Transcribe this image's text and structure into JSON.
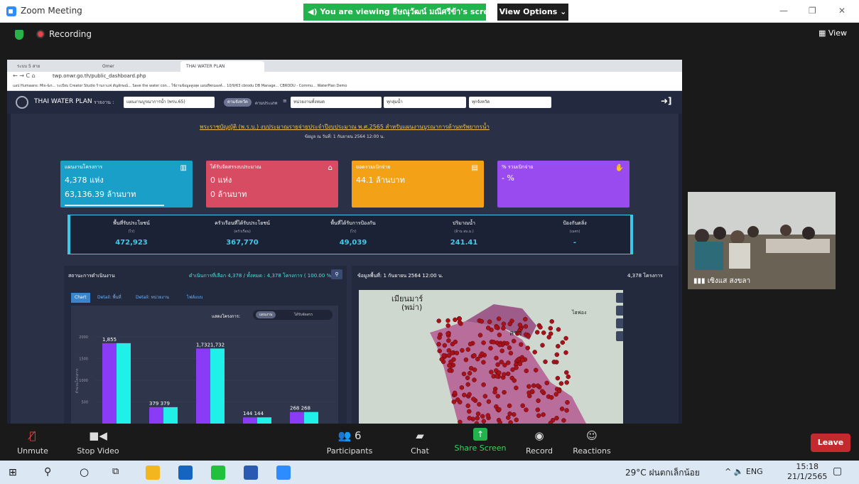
{
  "zoom": {
    "app_title": "Zoom Meeting",
    "share_banner": "You are viewing ธีษณุวัฒน์ มณีศรีข้า's screen",
    "view_options": "View Options",
    "recording": "Recording",
    "view": "View"
  },
  "browser": {
    "tabs": [
      "ระบบ 5 สาย",
      "Omer",
      "THAI WATER PLAN"
    ],
    "url": "twp.onwr.go.th/public_dashboard.php",
    "bookmarks": "แอป   Humaans: Mix-&n...   ระเบียบ   Creator Studio   ร้านกาแฟ สัญลักษณ์...   Save the water con...   ใช้งานข้อมูลสูงสุด   แผนทีพรมองค์...   10/9/63   cbrodu DB Manage...   CBRODU - Commu...   WaterPlan Demo"
  },
  "dashboard": {
    "brand": "THAI WATER PLAN",
    "nav_label": "รายงาน :",
    "nav_select": "แผนงานบูรณาการน้ำ (พรบ.65)",
    "pill_a": "ตามจังหวัด",
    "pill_b": "ตามประเภท",
    "select_agency": "หน่วยงานทั้งหมด",
    "select_basin": "ทุกลุ่มน้ำ",
    "select_province": "ทุกจังหวัด",
    "headline": "พระราชบัญญัติ (พ.ร.บ.) งบประมาณรายจ่ายประจำปีงบประมาณ พ.ศ.2565 สำหรับแผนงานบูรณาการด้านทรัพยากรน้ำ",
    "date": "ข้อมูล ณ วันที่: 1 กันยายน 2564 12:00 น.",
    "kpis": [
      {
        "title": "แผนงานโครงการ",
        "v1": "4,378 แห่ง",
        "v2": "63,136.39 ล้านบาท",
        "color": "#1aa0c8"
      },
      {
        "title": "ได้รับจัดสรรงบประมาณ",
        "v1": "0 แห่ง",
        "v2": "0 ล้านบาท",
        "color": "#d84c63"
      },
      {
        "title": "ยอดรวมเบิกจ่าย",
        "v1": "44.1 ล้านบาท",
        "v2": "",
        "color": "#f3a117"
      },
      {
        "title": "% รวมเบิกจ่าย",
        "v1": "- %",
        "v2": "",
        "color": "#9a4bf0"
      }
    ],
    "stats": [
      {
        "label": "พื้นที่รับประโยชน์",
        "unit": "(ไร่)",
        "value": "472,923"
      },
      {
        "label": "ครัวเรือนที่ได้รับประโยชน์",
        "unit": "(ครัวเรือน)",
        "value": "367,770"
      },
      {
        "label": "พื้นที่ได้รับการป้องกัน",
        "unit": "(ไร่)",
        "value": "49,039"
      },
      {
        "label": "ปริมาณน้ำ",
        "unit": "(ล้าน ลบ.ม.)",
        "value": "241.41"
      },
      {
        "label": "ป้องกันตลิ่ง",
        "unit": "(เมตร)",
        "value": "-"
      }
    ],
    "status_title": "สถานะการดำเนินงาน",
    "status_summary": "ดำเนินการที่เลือก 4,378 / ทั้งหมด : 4,378 โครงการ ( 100.00 % )",
    "chart_tabs": [
      "Chart",
      "Detail: พื้นที่",
      "Detail: หน่วยงาน",
      "ไฟล์แบบ"
    ],
    "filter_label": "แสดงโครงการ:",
    "filter_on": "แผนงาน",
    "filter_off": "ได้รับจัดสรร",
    "map_head": "ข้อมูลพื้นที่: 1 กันยายน 2564 12:00 น.",
    "map_count": "4,378 โครงการ",
    "map_labels": [
      "เมียนมาร์",
      "(พม่า)",
      "ลาว",
      "ไฮฟอง"
    ]
  },
  "chart_data": {
    "type": "bar",
    "ylabel": "จำนวนโครงการ",
    "ylim": [
      0,
      2000
    ],
    "yticks": [
      500,
      1000,
      1500,
      2000
    ],
    "series": [
      {
        "values": [
          1855,
          379,
          1732,
          144,
          268
        ],
        "color": "#8a3bf5"
      },
      {
        "values": [
          1855,
          379,
          1732,
          144,
          268
        ],
        "color": "#1ff0e8"
      }
    ],
    "bar_labels": [
      "1,855",
      "379  379",
      "1,7321,732",
      "144  144",
      "268  268"
    ]
  },
  "video": {
    "name": "เซิงแส สงขลา"
  },
  "toolbar": {
    "items": [
      {
        "name": "unmute",
        "label": "Unmute",
        "icon": "🎤"
      },
      {
        "name": "stop-video",
        "label": "Stop Video",
        "icon": "■◀"
      },
      {
        "name": "participants",
        "label": "Participants",
        "icon": "👥6"
      },
      {
        "name": "chat",
        "label": "Chat",
        "icon": "💬"
      },
      {
        "name": "share-screen",
        "label": "Share Screen",
        "icon": "↑"
      },
      {
        "name": "record",
        "label": "Record",
        "icon": "◉"
      },
      {
        "name": "reactions",
        "label": "Reactions",
        "icon": "☺"
      }
    ],
    "leave": "Leave"
  },
  "taskbar": {
    "weather": "29°C  ฝนตกเล็กน้อย",
    "tray": "^  🔈  ENG",
    "time": "15:18",
    "date": "21/1/2565"
  }
}
